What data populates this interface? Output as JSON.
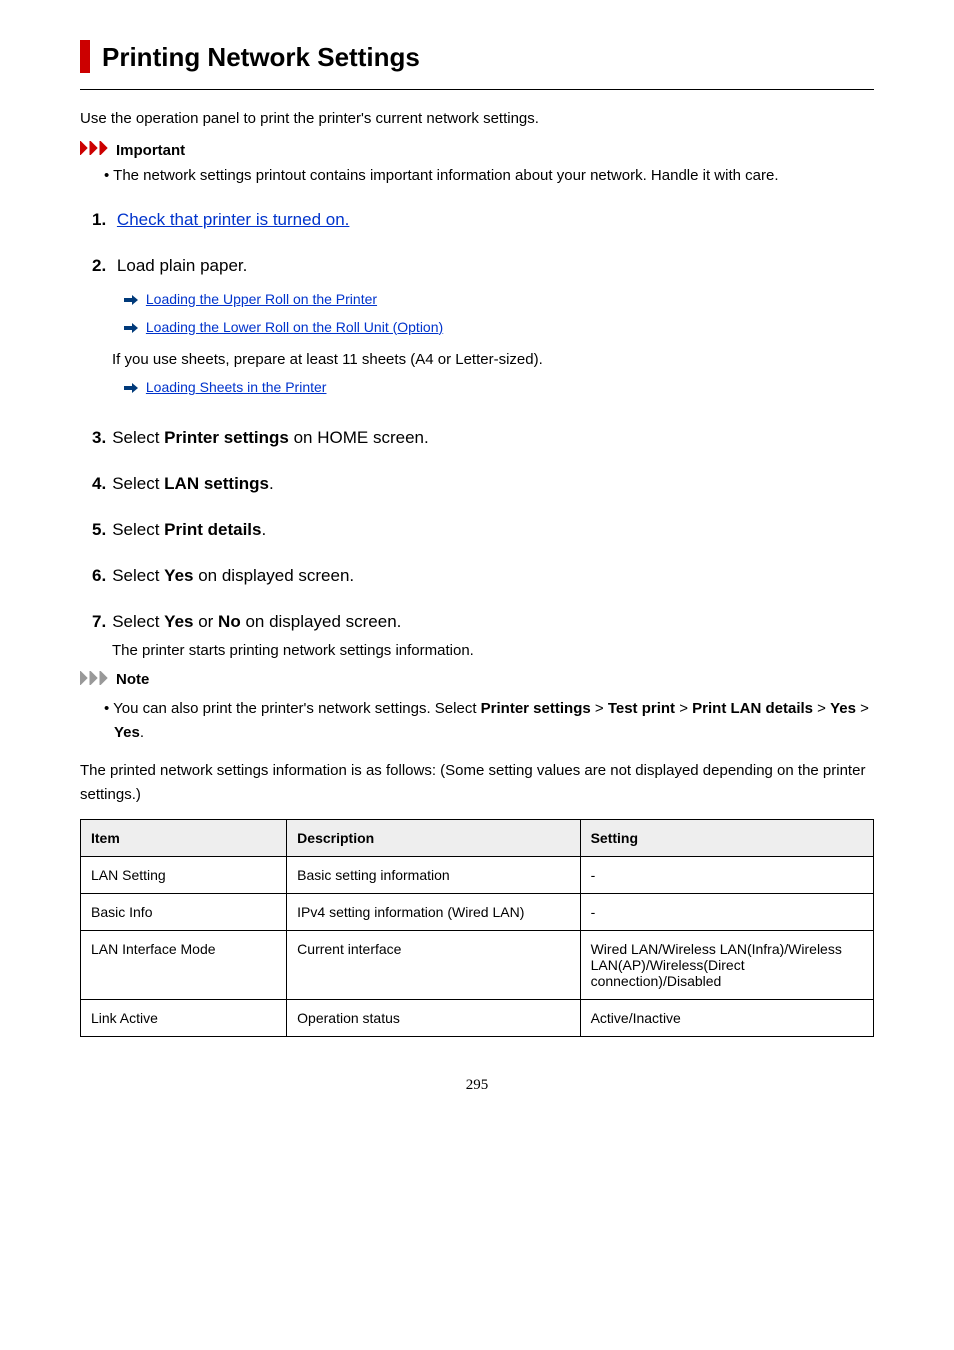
{
  "title": "Printing Network Settings",
  "intro": "Use the operation panel to print the printer's current network settings.",
  "important": {
    "label": "Important",
    "bullet": "The network settings printout contains important information about your network. Handle it with care."
  },
  "steps": {
    "s1": {
      "num": "1.",
      "link": "Check that printer is turned on."
    },
    "s2": {
      "num": "2.",
      "text": "Load plain paper.",
      "link1": "Loading the Upper Roll on the Printer",
      "link2": "Loading the Lower Roll on the Roll Unit (Option)",
      "mid": "If you use sheets, prepare at least 11 sheets (A4 or Letter-sized).",
      "link3": "Loading Sheets in the Printer"
    },
    "s3": {
      "num": "3.",
      "pre": "Select ",
      "bold": "Printer settings",
      "post": " on HOME screen."
    },
    "s4": {
      "num": "4.",
      "pre": "Select ",
      "bold": "LAN settings",
      "post": "."
    },
    "s5": {
      "num": "5.",
      "pre": "Select ",
      "bold": "Print details",
      "post": "."
    },
    "s6": {
      "num": "6.",
      "pre": "Select ",
      "bold": "Yes",
      "post": " on displayed screen."
    },
    "s7": {
      "num": "7.",
      "pre": "Select ",
      "bold1": "Yes",
      "mid": " or ",
      "bold2": "No",
      "post": " on displayed screen.",
      "result": "The printer starts printing network settings information."
    }
  },
  "note": {
    "label": "Note",
    "pre": "You can also print the printer's network settings. Select ",
    "b1": "Printer settings",
    "gt1": " > ",
    "b2": "Test print",
    "gt2": " > ",
    "b3": "Print LAN details",
    "gt3": " > ",
    "b4": "Yes",
    "gt4": " > ",
    "b5": "Yes",
    "end": "."
  },
  "after_note": "The printed network settings information is as follows: (Some setting values are not displayed depending on the printer settings.)",
  "table": {
    "headers": {
      "item": "Item",
      "desc": "Description",
      "setting": "Setting"
    },
    "rows": [
      {
        "item": "LAN Setting",
        "desc": "Basic setting information",
        "setting": "-"
      },
      {
        "item": "Basic Info",
        "desc": "IPv4 setting information (Wired LAN)",
        "setting": "-"
      },
      {
        "item": "LAN Interface Mode",
        "desc": "Current interface",
        "setting": "Wired LAN/Wireless LAN(Infra)/Wireless LAN(AP)/Wireless(Direct connection)/Disabled"
      },
      {
        "item": "Link Active",
        "desc": "Operation status",
        "setting": "Active/Inactive"
      }
    ]
  },
  "page_number": "295"
}
